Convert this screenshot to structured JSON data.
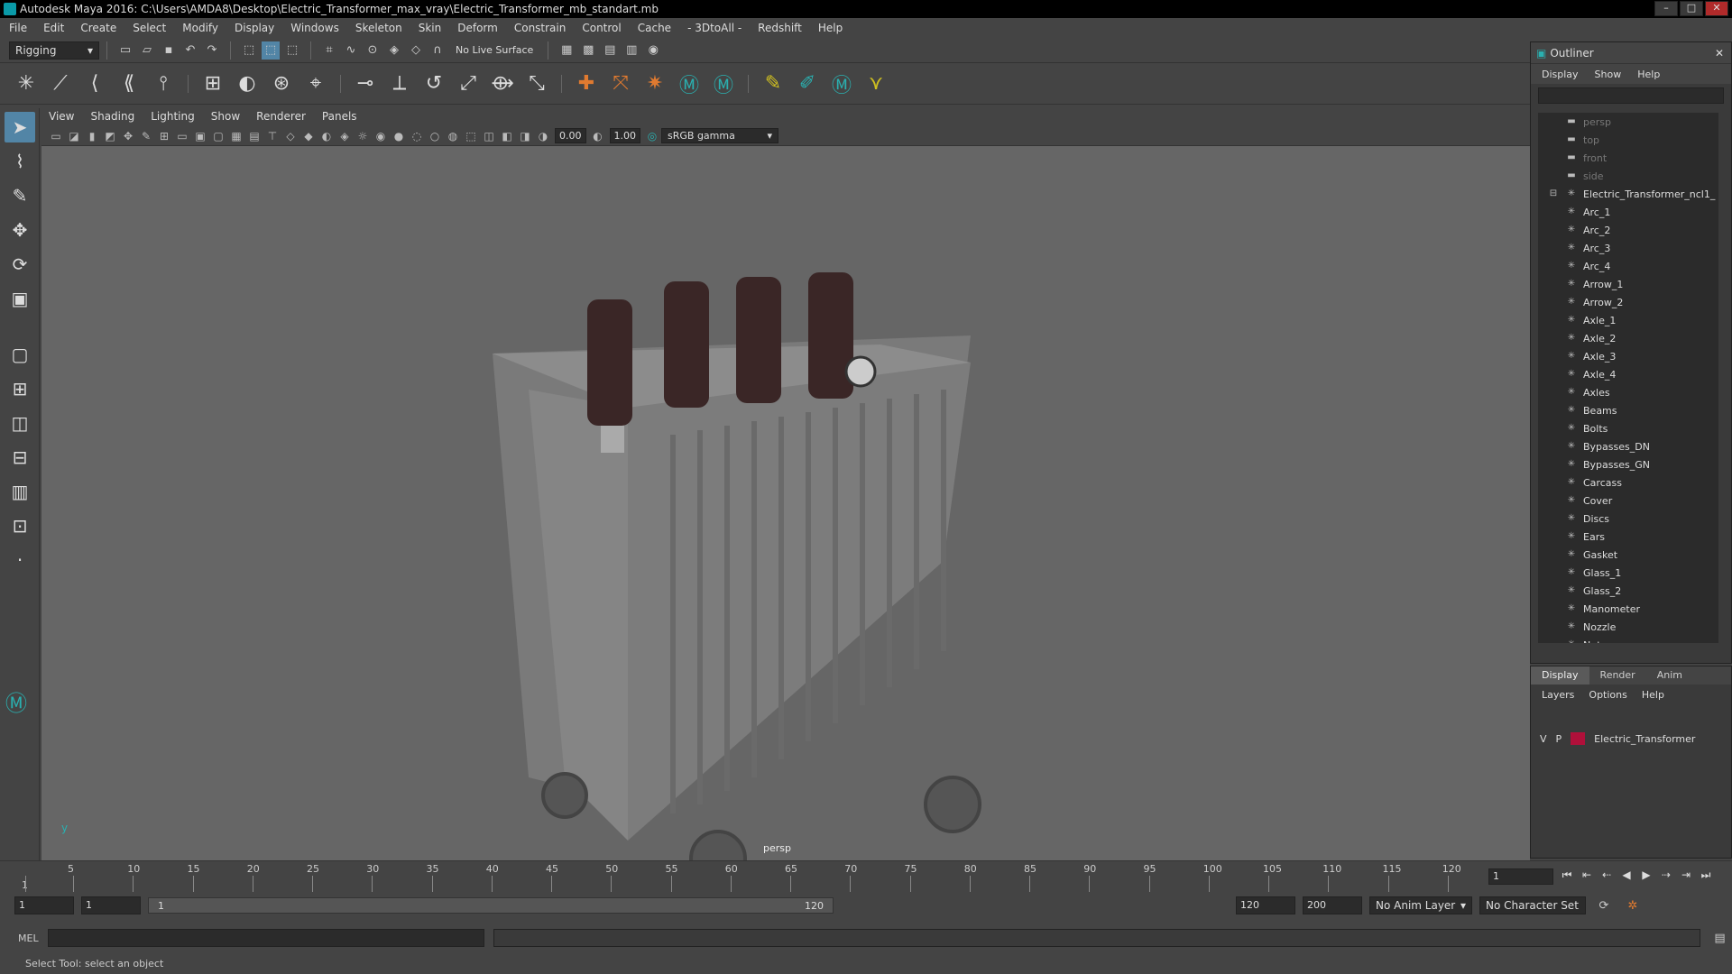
{
  "window": {
    "title": "Autodesk Maya 2016: C:\\Users\\AMDA8\\Desktop\\Electric_Transformer_max_vray\\Electric_Transformer_mb_standart.mb"
  },
  "menubar": [
    "File",
    "Edit",
    "Create",
    "Select",
    "Modify",
    "Display",
    "Windows",
    "Skeleton",
    "Skin",
    "Deform",
    "Constrain",
    "Control",
    "Cache",
    "- 3DtoAll -",
    "Redshift",
    "Help"
  ],
  "statusline": {
    "mode": "Rigging",
    "live_surface": "No Live Surface"
  },
  "viewport": {
    "menu": [
      "View",
      "Shading",
      "Lighting",
      "Show",
      "Renderer",
      "Panels"
    ],
    "exposure": "0.00",
    "gamma": "1.00",
    "color_space": "sRGB gamma",
    "camera": "persp"
  },
  "outliner": {
    "title": "Outliner",
    "menu": [
      "Display",
      "Show",
      "Help"
    ],
    "cameras": [
      "persp",
      "top",
      "front",
      "side"
    ],
    "group": "Electric_Transformer_ncl1_",
    "items": [
      "Arc_1",
      "Arc_2",
      "Arc_3",
      "Arc_4",
      "Arrow_1",
      "Arrow_2",
      "Axle_1",
      "Axle_2",
      "Axle_3",
      "Axle_4",
      "Axles",
      "Beams",
      "Bolts",
      "Bypasses_DN",
      "Bypasses_GN",
      "Carcass",
      "Cover",
      "Discs",
      "Ears",
      "Gasket",
      "Glass_1",
      "Glass_2",
      "Manometer",
      "Nozzle",
      "Nut"
    ]
  },
  "layers": {
    "tabs": [
      "Display",
      "Render",
      "Anim"
    ],
    "menu": [
      "Layers",
      "Options",
      "Help"
    ],
    "layer": {
      "v": "V",
      "p": "P",
      "name": "Electric_Transformer",
      "color": "#b0103a"
    }
  },
  "timeline": {
    "ticks": [
      "1",
      "5",
      "10",
      "15",
      "20",
      "25",
      "30",
      "35",
      "40",
      "45",
      "50",
      "55",
      "60",
      "65",
      "70",
      "75",
      "80",
      "85",
      "90",
      "95",
      "100",
      "105",
      "110",
      "115",
      "120"
    ],
    "current_frame": "1"
  },
  "range": {
    "start": "1",
    "playback_start": "1",
    "slider_start": "1",
    "slider_end": "120",
    "playback_end": "120",
    "end": "200",
    "anim_layer": "No Anim Layer",
    "character_set": "No Character Set"
  },
  "cmdline": {
    "label": "MEL"
  },
  "helpline": {
    "text": "Select Tool: select an object"
  }
}
